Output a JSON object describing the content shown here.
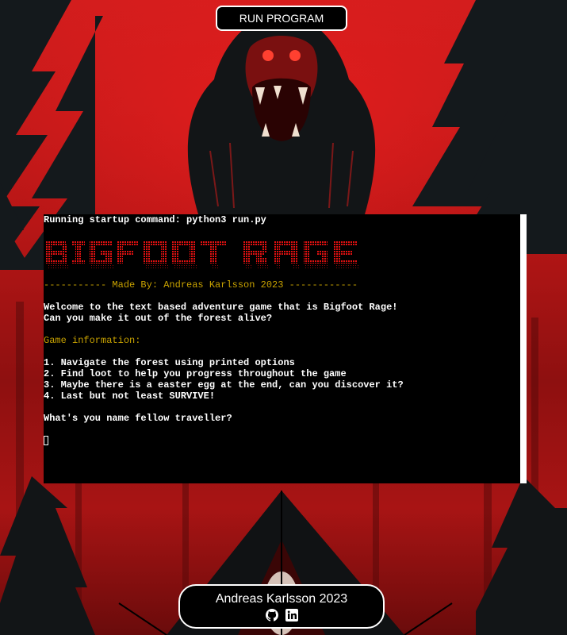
{
  "toolbar": {
    "run_label": "RUN PROGRAM"
  },
  "terminal": {
    "startup": "Running startup command: python3 run.py",
    "banner_alt": "BIGFOOT RAGE",
    "made_by": "----------- Made By: Andreas Karlsson 2023 ------------",
    "welcome_1": "Welcome to the text based adventure game that is Bigfoot Rage!",
    "welcome_2": "Can you make it out of the forest alive?",
    "info_heading": "Game information:",
    "info_items": [
      "1. Navigate the forest using printed options",
      "2. Find loot to help you progress throughout the game",
      "3. Maybe there is a easter egg at the end, can you discover it?",
      "4. Last but not least SURVIVE!"
    ],
    "prompt": "What's you name fellow traveller?"
  },
  "footer": {
    "name": "Andreas Karlsson 2023",
    "icons": [
      "github-icon",
      "linkedin-icon"
    ]
  },
  "colors": {
    "accent_gold": "#c8a200",
    "banner_red": "#e01010",
    "background_red": "#c41a1a"
  }
}
